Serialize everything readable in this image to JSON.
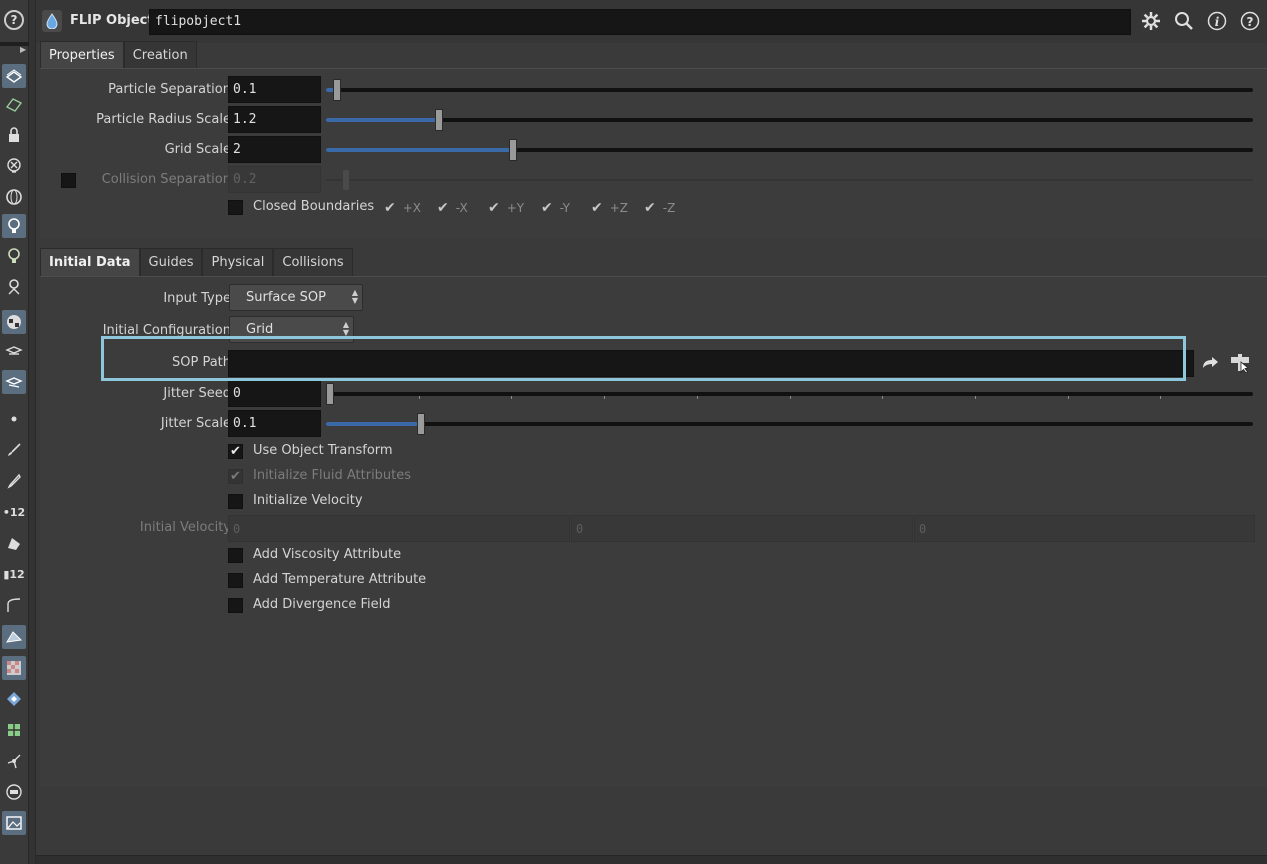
{
  "header": {
    "node_type": "FLIP Object",
    "node_name": "flipobject1",
    "icons": [
      "gear-icon",
      "search-icon",
      "info-icon",
      "help-icon"
    ]
  },
  "sidebar": {
    "tools": [
      "help-icon",
      "display-icon",
      "template-icon",
      "lock-icon",
      "ghost-icon",
      "sphere-icon",
      "light-icon",
      "bulb-icon",
      "light-probe-icon",
      "material-icon",
      "camera-icon",
      "camera-view-icon",
      "point-icon",
      "brush-icon",
      "pen-icon",
      "number-tool-icon",
      "paint-icon",
      "number-paint-icon",
      "curve-icon",
      "surface-icon",
      "checker-icon",
      "diamond-icon",
      "grid-icon",
      "node-icon",
      "minus-icon",
      "image-icon"
    ]
  },
  "top_tabs": [
    {
      "label": "Properties",
      "active": true
    },
    {
      "label": "Creation",
      "active": false
    }
  ],
  "properties": {
    "particle_separation": {
      "label": "Particle Separation",
      "value": "0.1",
      "slider_fraction": 0.01
    },
    "particle_radius_scale": {
      "label": "Particle Radius Scale",
      "value": "1.2",
      "slider_fraction": 0.12
    },
    "grid_scale": {
      "label": "Grid Scale",
      "value": "2",
      "slider_fraction": 0.2
    },
    "collision_separation": {
      "label": "Collision Separation",
      "value": "0.2",
      "enabled": false
    },
    "closed_boundaries": {
      "label": "Closed Boundaries",
      "axes": [
        "+X",
        "-X",
        "+Y",
        "-Y",
        "+Z",
        "-Z"
      ]
    }
  },
  "bottom_tabs": [
    {
      "label": "Initial Data",
      "active": true
    },
    {
      "label": "Guides",
      "active": false
    },
    {
      "label": "Physical",
      "active": false
    },
    {
      "label": "Collisions",
      "active": false
    }
  ],
  "initial_data": {
    "input_type": {
      "label": "Input Type",
      "value": "Surface SOP"
    },
    "initial_configuration": {
      "label": "Initial Configuration",
      "value": "Grid"
    },
    "sop_path": {
      "label": "SOP Path",
      "value": ""
    },
    "jitter_seed": {
      "label": "Jitter Seed",
      "value": "0",
      "slider_fraction": 0.0
    },
    "jitter_scale": {
      "label": "Jitter Scale",
      "value": "0.1",
      "slider_fraction": 0.1
    },
    "use_object_transform": {
      "label": "Use Object Transform",
      "checked": true
    },
    "initialize_fluid_attributes": {
      "label": "Initialize Fluid Attributes",
      "checked": true,
      "enabled": false
    },
    "initialize_velocity": {
      "label": "Initialize Velocity",
      "checked": false
    },
    "initial_velocity": {
      "label": "Initial Velocity",
      "values": [
        "0",
        "0",
        "0"
      ],
      "enabled": false
    },
    "add_viscosity_attribute": {
      "label": "Add Viscosity Attribute",
      "checked": false
    },
    "add_temperature_attribute": {
      "label": "Add Temperature Attribute",
      "checked": false
    },
    "add_divergence_field": {
      "label": "Add Divergence Field",
      "checked": false
    }
  },
  "colors": {
    "highlight": "#8ec7dc",
    "slider_fill": "#3a6aa8",
    "background": "#3a3a3a"
  }
}
